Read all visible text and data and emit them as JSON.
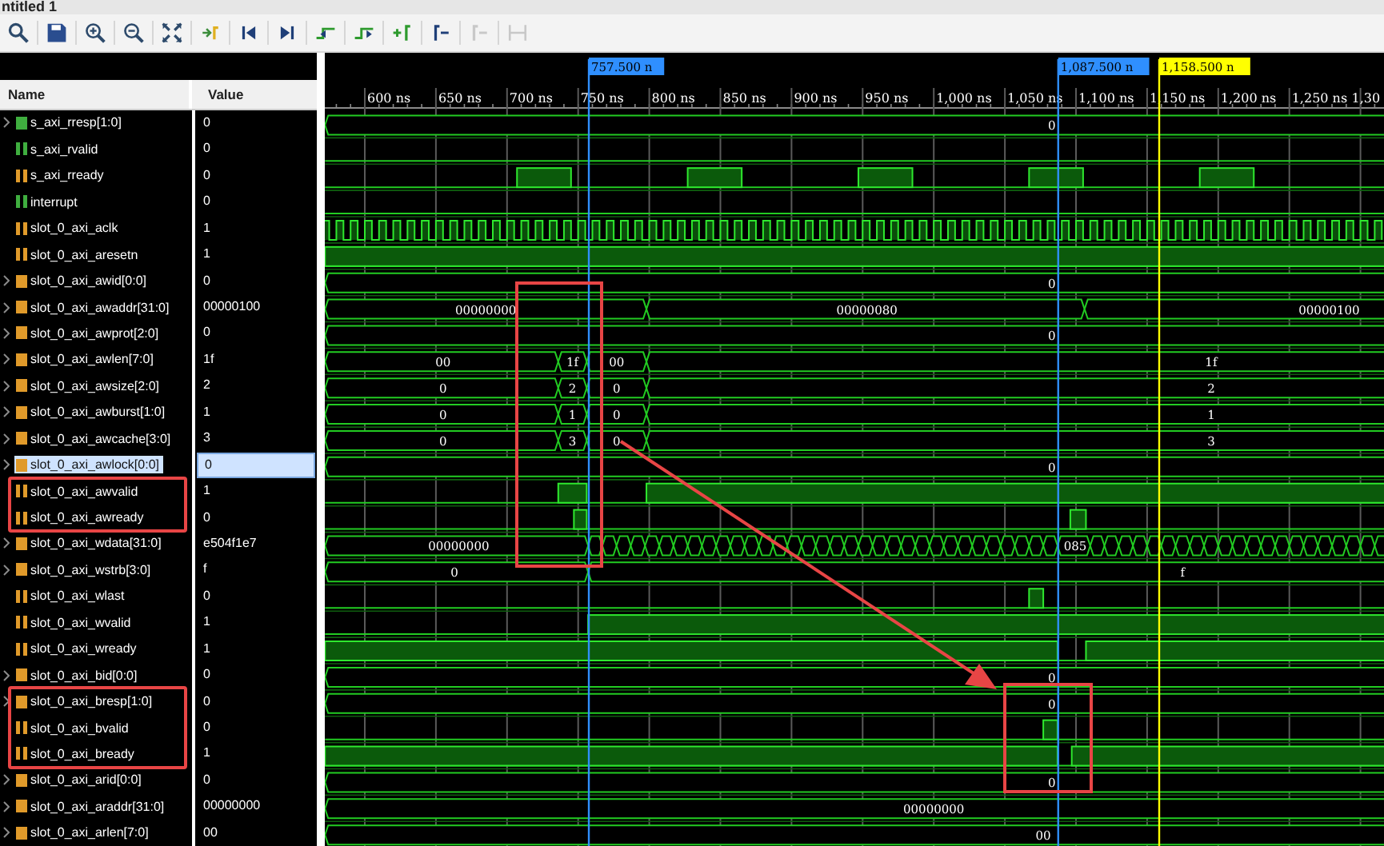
{
  "window": {
    "title": "ntitled 1"
  },
  "toolbar": [
    {
      "kind": "search",
      "disabled": false
    },
    {
      "kind": "save",
      "disabled": false
    },
    {
      "kind": "zoom_in",
      "disabled": false
    },
    {
      "kind": "zoom_out",
      "disabled": false
    },
    {
      "kind": "fit",
      "disabled": false
    },
    {
      "kind": "to_cursor",
      "disabled": false
    },
    {
      "kind": "go_start",
      "disabled": false
    },
    {
      "kind": "go_end",
      "disabled": false
    },
    {
      "kind": "prev_edge",
      "disabled": false
    },
    {
      "kind": "next_edge",
      "disabled": false
    },
    {
      "kind": "add_marker",
      "disabled": false
    },
    {
      "kind": "prev_marker",
      "disabled": false
    },
    {
      "kind": "next_marker",
      "disabled": true
    },
    {
      "kind": "swap",
      "disabled": true
    }
  ],
  "columns": {
    "name": "Name",
    "value": "Value"
  },
  "timeline": {
    "ticks": [
      "600 ns",
      "650 ns",
      "700 ns",
      "750 ns",
      "800 ns",
      "850 ns",
      "900 ns",
      "950 ns",
      "1,000 ns",
      "1,050 ns",
      "1,100 ns",
      "1,150 ns",
      "1,200 ns",
      "1,250 ns",
      "1,30"
    ],
    "cursors": [
      {
        "label": "757.500 n",
        "kind": "marker"
      },
      {
        "label": "1,087.500 n",
        "kind": "marker"
      },
      {
        "label": "1,158.500 n",
        "kind": "main"
      }
    ]
  },
  "signals": [
    {
      "name": "s_axi_rresp[1:0]",
      "value": "0",
      "kind": "bus",
      "color": "#3fae3f",
      "selected": false,
      "boxed": false,
      "wave_labels": [
        "0"
      ]
    },
    {
      "name": "s_axi_rvalid",
      "value": "0",
      "kind": "bit",
      "color": "#3fae3f",
      "selected": false,
      "boxed": false
    },
    {
      "name": "s_axi_rready",
      "value": "0",
      "kind": "bit",
      "color": "#e09a2a",
      "selected": false,
      "boxed": false
    },
    {
      "name": "interrupt",
      "value": "0",
      "kind": "bit",
      "color": "#3fae3f",
      "selected": false,
      "boxed": false
    },
    {
      "name": "slot_0_axi_aclk",
      "value": "1",
      "kind": "bit",
      "color": "#e09a2a",
      "selected": false,
      "boxed": false
    },
    {
      "name": "slot_0_axi_aresetn",
      "value": "1",
      "kind": "bit",
      "color": "#e09a2a",
      "selected": false,
      "boxed": false
    },
    {
      "name": "slot_0_axi_awid[0:0]",
      "value": "0",
      "kind": "bus",
      "color": "#e09a2a",
      "selected": false,
      "boxed": false,
      "wave_labels": [
        "0"
      ]
    },
    {
      "name": "slot_0_axi_awaddr[31:0]",
      "value": "00000100",
      "kind": "bus",
      "color": "#e09a2a",
      "selected": false,
      "boxed": false,
      "wave_labels": [
        "00000000",
        "00000080",
        "00000100"
      ]
    },
    {
      "name": "slot_0_axi_awprot[2:0]",
      "value": "0",
      "kind": "bus",
      "color": "#e09a2a",
      "selected": false,
      "boxed": false,
      "wave_labels": [
        "0"
      ]
    },
    {
      "name": "slot_0_axi_awlen[7:0]",
      "value": "1f",
      "kind": "bus",
      "color": "#e09a2a",
      "selected": false,
      "boxed": false,
      "wave_labels": [
        "00",
        "1f",
        "00",
        "1f"
      ]
    },
    {
      "name": "slot_0_axi_awsize[2:0]",
      "value": "2",
      "kind": "bus",
      "color": "#e09a2a",
      "selected": false,
      "boxed": false,
      "wave_labels": [
        "0",
        "2",
        "0",
        "2"
      ]
    },
    {
      "name": "slot_0_axi_awburst[1:0]",
      "value": "1",
      "kind": "bus",
      "color": "#e09a2a",
      "selected": false,
      "boxed": false,
      "wave_labels": [
        "0",
        "1",
        "0",
        "1"
      ]
    },
    {
      "name": "slot_0_axi_awcache[3:0]",
      "value": "3",
      "kind": "bus",
      "color": "#e09a2a",
      "selected": false,
      "boxed": false,
      "wave_labels": [
        "0",
        "3",
        "0",
        "3"
      ]
    },
    {
      "name": "slot_0_axi_awlock[0:0]",
      "value": "0",
      "kind": "bus",
      "color": "#e09a2a",
      "selected": true,
      "boxed": false,
      "wave_labels": [
        "0"
      ]
    },
    {
      "name": "slot_0_axi_awvalid",
      "value": "1",
      "kind": "bit",
      "color": "#e09a2a",
      "selected": false,
      "boxed": true
    },
    {
      "name": "slot_0_axi_awready",
      "value": "0",
      "kind": "bit",
      "color": "#e09a2a",
      "selected": false,
      "boxed": true
    },
    {
      "name": "slot_0_axi_wdata[31:0]",
      "value": "e504f1e7",
      "kind": "bus",
      "color": "#e09a2a",
      "selected": false,
      "boxed": false,
      "wave_labels": [
        "00000000",
        "085"
      ]
    },
    {
      "name": "slot_0_axi_wstrb[3:0]",
      "value": "f",
      "kind": "bus",
      "color": "#e09a2a",
      "selected": false,
      "boxed": false,
      "wave_labels": [
        "0",
        "f"
      ]
    },
    {
      "name": "slot_0_axi_wlast",
      "value": "0",
      "kind": "bit",
      "color": "#e09a2a",
      "selected": false,
      "boxed": false
    },
    {
      "name": "slot_0_axi_wvalid",
      "value": "1",
      "kind": "bit",
      "color": "#e09a2a",
      "selected": false,
      "boxed": false
    },
    {
      "name": "slot_0_axi_wready",
      "value": "1",
      "kind": "bit",
      "color": "#e09a2a",
      "selected": false,
      "boxed": false
    },
    {
      "name": "slot_0_axi_bid[0:0]",
      "value": "0",
      "kind": "bus",
      "color": "#e09a2a",
      "selected": false,
      "boxed": false,
      "wave_labels": [
        "0"
      ]
    },
    {
      "name": "slot_0_axi_bresp[1:0]",
      "value": "0",
      "kind": "bus",
      "color": "#e09a2a",
      "selected": false,
      "boxed": true,
      "wave_labels": [
        "0"
      ]
    },
    {
      "name": "slot_0_axi_bvalid",
      "value": "0",
      "kind": "bit",
      "color": "#e09a2a",
      "selected": false,
      "boxed": true
    },
    {
      "name": "slot_0_axi_bready",
      "value": "1",
      "kind": "bit",
      "color": "#e09a2a",
      "selected": false,
      "boxed": true
    },
    {
      "name": "slot_0_axi_arid[0:0]",
      "value": "0",
      "kind": "bus",
      "color": "#e09a2a",
      "selected": false,
      "boxed": false,
      "wave_labels": [
        "0"
      ]
    },
    {
      "name": "slot_0_axi_araddr[31:0]",
      "value": "00000000",
      "kind": "bus",
      "color": "#e09a2a",
      "selected": false,
      "boxed": false,
      "wave_labels": [
        "00000000"
      ]
    },
    {
      "name": "slot_0_axi_arlen[7:0]",
      "value": "00",
      "kind": "bus",
      "color": "#e09a2a",
      "selected": false,
      "boxed": false,
      "wave_labels": [
        "00"
      ]
    }
  ]
}
